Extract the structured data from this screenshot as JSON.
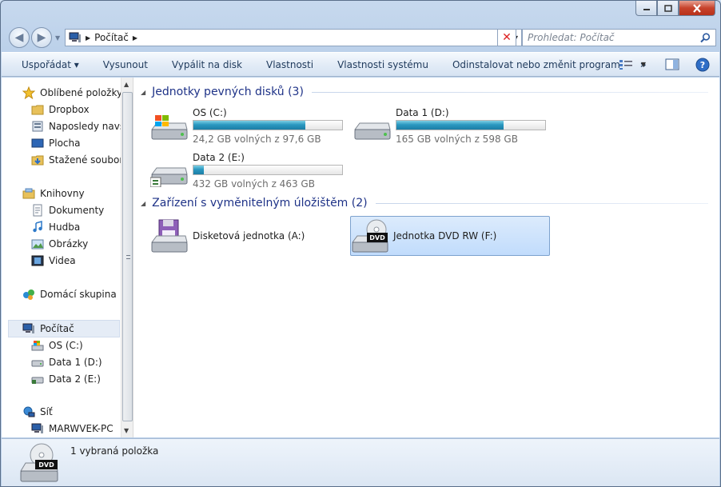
{
  "window": {
    "caption_buttons": {
      "minimize": "minimize-icon",
      "maximize": "maximize-icon",
      "close": "close-icon"
    }
  },
  "address": {
    "crumb": "Počítač",
    "search_placeholder": "Prohledat: Počítač"
  },
  "toolbar": {
    "items": [
      "Uspořádat ▾",
      "Vysunout",
      "Vypálit na disk",
      "Vlastnosti",
      "Vlastnosti systému",
      "Odinstalovat nebo změnit program"
    ],
    "more": "»",
    "view_icon": "view-options-icon",
    "pane_icon": "preview-pane-icon",
    "help_icon": "help-icon"
  },
  "sidebar": {
    "favorites": {
      "label": "Oblíbené položky",
      "items": [
        "Dropbox",
        "Naposledy navští",
        "Plocha",
        "Stažené soubory"
      ]
    },
    "libraries": {
      "label": "Knihovny",
      "items": [
        "Dokumenty",
        "Hudba",
        "Obrázky",
        "Videa"
      ]
    },
    "homegroup": "Domácí skupina",
    "computer": {
      "label": "Počítač",
      "items": [
        "OS (C:)",
        "Data 1 (D:)",
        "Data 2 (E:)"
      ]
    },
    "network": {
      "label": "Síť",
      "items": [
        "MARWVEK-PC"
      ]
    }
  },
  "main": {
    "hdd_group": "Jednotky pevných disků (3)",
    "drives": [
      {
        "name": "OS (C:)",
        "free": "24,2 GB volných z 97,6 GB",
        "used_fraction": 0.75
      },
      {
        "name": "Data 1 (D:)",
        "free": "165 GB volných z 598 GB",
        "used_fraction": 0.72
      },
      {
        "name": "Data 2 (E:)",
        "free": "432 GB volných z 463 GB",
        "used_fraction": 0.07
      }
    ],
    "removable_group": "Zařízení s vyměnitelným úložištěm (2)",
    "devices": [
      {
        "name": "Disketová jednotka (A:)"
      },
      {
        "name": "Jednotka DVD RW (F:)",
        "badge": "DVD"
      }
    ]
  },
  "status": {
    "text": "1 vybraná položka",
    "badge": "DVD"
  },
  "colors": {
    "bar_fill": "#2a98c0",
    "selection": "#c1dcfc",
    "group_heading": "#1e3287"
  }
}
